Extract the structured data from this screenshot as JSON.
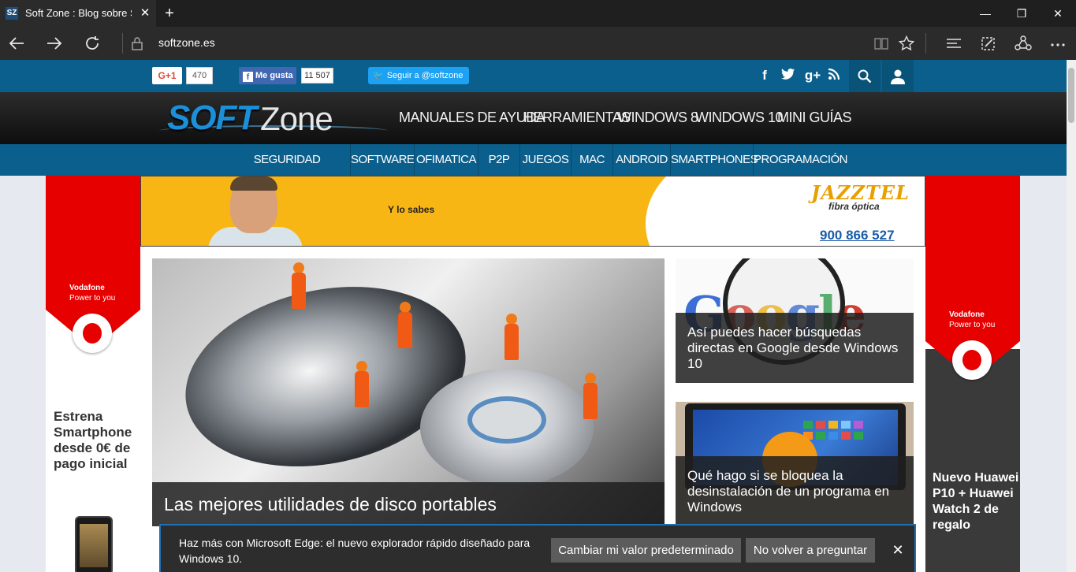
{
  "browser": {
    "tab_favicon": "SZ",
    "tab_title": "Soft Zone : Blog sobre S",
    "tab_close": "✕",
    "new_tab": "+",
    "url": "softzone.es",
    "window_controls": {
      "minimize": "—",
      "restore": "❐",
      "close": "✕"
    },
    "icons": [
      "back-icon",
      "forward-icon",
      "refresh-icon",
      "lock-icon",
      "reading-view-icon",
      "favorite-star-icon",
      "hub-icon",
      "web-note-icon",
      "share-icon",
      "more-icon"
    ]
  },
  "social_bar": {
    "gplus_label": "G+1",
    "gplus_count": "470",
    "fb_icon": "f",
    "fb_label": "Me gusta",
    "fb_count": "11 507",
    "twitter_label": "Seguir a @softzone",
    "icons": {
      "facebook": "f",
      "twitter": "🐦",
      "gplus": "g+",
      "rss": "rss"
    },
    "search_icon": "⌕",
    "user_icon": "👤"
  },
  "header": {
    "logo_soft": "SOFT",
    "logo_zone": "Zone",
    "nav": [
      "MANUALES DE AYUDA",
      "HERRAMIENTAS",
      "WINDOWS 8",
      "WINDOWS 10",
      "MINI GUÍAS"
    ]
  },
  "subnav": [
    "SEGURIDAD INFORMÁTICA",
    "SOFTWARE",
    "OFIMATICA",
    "P2P",
    "JUEGOS",
    "MAC",
    "ANDROID",
    "SMARTPHONES",
    "PROGRAMACIÓN"
  ],
  "left_ad": {
    "brand": "Vodafone",
    "tagline": "Power to you",
    "text": "Estrena Smartphone desde 0€ de pago inicial"
  },
  "right_ad": {
    "brand": "Vodafone",
    "tagline": "Power to you",
    "text": "Nuevo Huawei P10 + Huawei Watch 2 de regalo"
  },
  "banner": {
    "text": "Y lo sabes",
    "brand": "JAZZTEL",
    "sub": "fibra óptica",
    "phone": "900 866 527"
  },
  "articles": {
    "main_title": "Las mejores utilidades de disco portables",
    "side1_title": "Así puedes hacer búsquedas directas en Google desde Windows 10",
    "side2_title": "Qué hago si se bloquea la desinstalación de un programa en Windows"
  },
  "notification": {
    "text": "Haz más con Microsoft Edge: el nuevo explorador rápido diseñado para Windows 10.",
    "btn_default": "Cambiar mi valor predeterminado",
    "btn_never": "No volver a preguntar",
    "close": "✕"
  }
}
